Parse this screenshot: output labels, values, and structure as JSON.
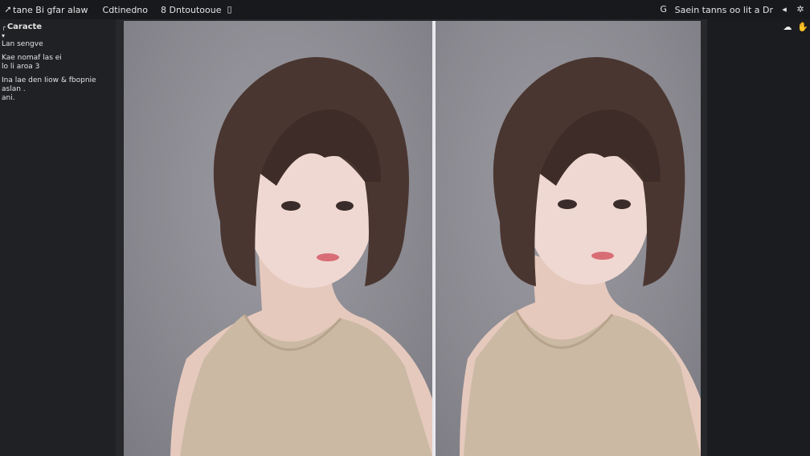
{
  "topbar": {
    "tabs": [
      {
        "label": "tane Bi gfar alaw",
        "icon": "arrow-icon"
      },
      {
        "label": "Cdtinedno"
      },
      {
        "label": "8 Dntoutooue",
        "icon": "bookmark-icon"
      }
    ],
    "right_text": "Saein tanns oo lit a Dr",
    "right_icons": [
      "refresh-icon",
      "arrow-left-icon",
      "gear-icon"
    ]
  },
  "left_panel": {
    "title": "Caracte",
    "rows_group1": [
      "Lan sengve"
    ],
    "rows_group2": [
      "Kae nomaf las ei",
      "lo li aroa 3"
    ],
    "rows_group3": [
      "Ina lae den Iiow & fbopnie",
      "aslan ."
    ],
    "rows_group4": [
      "ani."
    ]
  },
  "canvas": {
    "images": [
      {
        "name": "portrait-left",
        "subject": "portrait"
      },
      {
        "name": "portrait-right",
        "subject": "portrait"
      }
    ],
    "colors": {
      "background": "#8c8b93",
      "divider": "#e9e9ee"
    }
  },
  "right_panel": {
    "icons": [
      "cloud-icon",
      "hand-icon"
    ]
  }
}
